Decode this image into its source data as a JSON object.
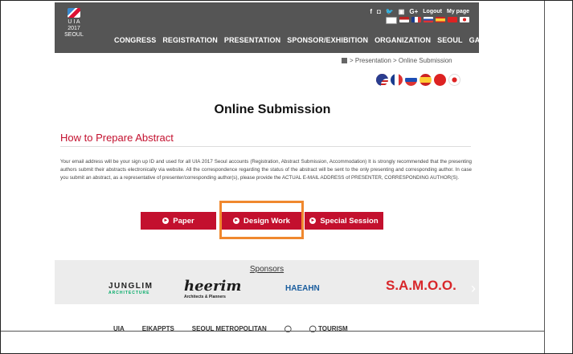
{
  "header": {
    "logo_text": "U I A\n2017\nSEOUL",
    "top_links": [
      "f",
      "◘",
      "🐦",
      "▣",
      "G+",
      "Logout",
      "My page"
    ],
    "nav": [
      "CONGRESS",
      "REGISTRATION",
      "PRESENTATION",
      "SPONSOR/EXHIBITION",
      "ORGANIZATION",
      "SEOUL",
      "GALLERY"
    ]
  },
  "breadcrumb": "> Presentation > Online Submission",
  "languages": [
    "en",
    "fr",
    "ru",
    "es",
    "zh",
    "ja"
  ],
  "page_title": "Online Submission",
  "section_title": "How to Prepare Abstract",
  "paragraph": "Your email address will be your sign up ID and used for all UIA 2017 Seoul accounts (Registration, Abstract Submission, Accommodation) It is strongly recommended that the presenting authors submit their abstracts electronically via website. All the correspondence regarding the status of the abstract will be sent to the only presenting and corresponding author. In case you submit an abstract, as a representative of presenter/corresponding author(s), please provide the ACTUAL E-MAIL ADDRESS of PRESENTER, CORRESPONDING AUTHOR(S).",
  "buttons": {
    "paper": "Paper",
    "design_work": "Design Work",
    "special_session": "Special Session"
  },
  "sponsors": {
    "title": "Sponsors",
    "logos": [
      "JUNGLIM",
      "ARCHITECTURE",
      "heerim",
      "Architects & Planners",
      "HAEAHN",
      "S.A.M.O.O."
    ]
  },
  "bottom_logos": [
    "UIA",
    "EIKAPPTS",
    "SEOUL METROPOLITAN",
    "◯",
    "◯ TOURISM"
  ],
  "colors": {
    "header": "#555555",
    "accent": "#c3102e",
    "highlight": "#f0882e"
  }
}
